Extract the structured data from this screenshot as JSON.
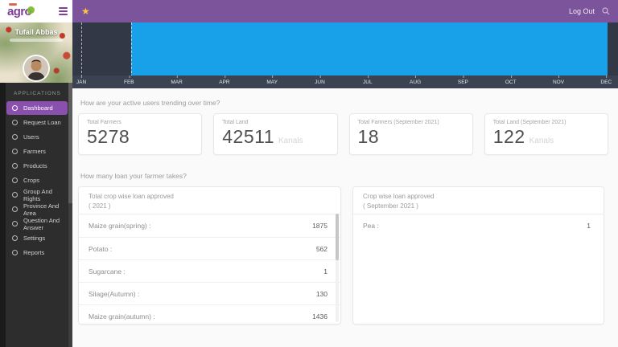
{
  "brand": {
    "logo_text": "agro"
  },
  "topbar": {
    "logout_label": "Log Out"
  },
  "profile": {
    "name": "Tufail Abbas"
  },
  "sidebar": {
    "section_label": "APPLICATIONS",
    "items": [
      {
        "label": "Dashboard",
        "active": true
      },
      {
        "label": "Request Loan"
      },
      {
        "label": "Users"
      },
      {
        "label": "Farmers"
      },
      {
        "label": "Products"
      },
      {
        "label": "Crops"
      },
      {
        "label": "Group And Rights"
      },
      {
        "label": "Province And Area"
      },
      {
        "label": "Question And Answer"
      },
      {
        "label": "Settings"
      },
      {
        "label": "Reports"
      }
    ]
  },
  "questions": {
    "active_users": "How are your active users trending over time?",
    "loans": "How many loan your farmer takes?"
  },
  "chart": {
    "months": [
      "JAN",
      "FEB",
      "MAR",
      "APR",
      "MAY",
      "JUN",
      "JUL",
      "AUG",
      "SEP",
      "OCT",
      "NOV",
      "DEC"
    ],
    "highlight_color": "#18a0e8",
    "highlight_range": "FEB-DEC"
  },
  "stats": [
    {
      "label": "Total Farmers",
      "value": "5278"
    },
    {
      "label": "Total Land",
      "value": "42511",
      "suffix": "Kanals"
    },
    {
      "label": "Total Farmers (September 2021)",
      "value": "18"
    },
    {
      "label": "Total Land (September 2021)",
      "value": "122",
      "suffix": "Kanals"
    }
  ],
  "loan_cards": [
    {
      "title_line1": "Total crop wise loan approved",
      "title_line2": "( 2021 )",
      "rows": [
        {
          "label": "Maize grain(spring) :",
          "value": "1875"
        },
        {
          "label": "Potato :",
          "value": "562"
        },
        {
          "label": "Sugarcane :",
          "value": "1"
        },
        {
          "label": "Silage(Autumn) :",
          "value": "130"
        },
        {
          "label": "Maize grain(autumn) :",
          "value": "1436"
        }
      ]
    },
    {
      "title_line1": "Crop wise loan approved",
      "title_line2": "( September 2021 )",
      "rows": [
        {
          "label": "Pea :",
          "value": "1"
        }
      ]
    }
  ]
}
